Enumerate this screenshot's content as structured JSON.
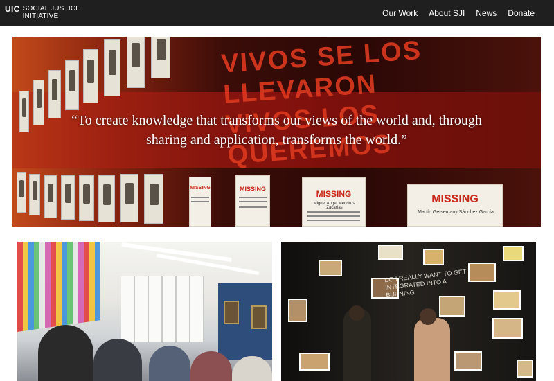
{
  "header": {
    "logo_mark": "UIC",
    "logo_line1": "SOCIAL JUSTICE",
    "logo_line2": "INITIATIVE",
    "nav": [
      "Our Work",
      "About SJI",
      "News",
      "Donate"
    ]
  },
  "hero": {
    "quote_line1": "“To create knowledge that transforms our views of the world and, through",
    "quote_line2": "sharing and application, transforms the world.”",
    "wall_text_line1": "VIVOS SE LOS LLEVARON",
    "wall_text_line2": "VIVOS LOS QUEREMOS",
    "poster_title": "MISSING",
    "poster_names": [
      "Miguel Angel Mendoza Zacarías",
      "Martín Getsemany Sánchez García"
    ]
  },
  "photos": {
    "left_alt": "classroom-photo",
    "right_alt": "chalkboard-wall-photo",
    "chalk_text": "DO I REALLY WANT TO GET INTEGRATED INTO A BURNING"
  },
  "colors": {
    "header_bg": "#1f1f1f",
    "accent_red": "#c8261a"
  }
}
